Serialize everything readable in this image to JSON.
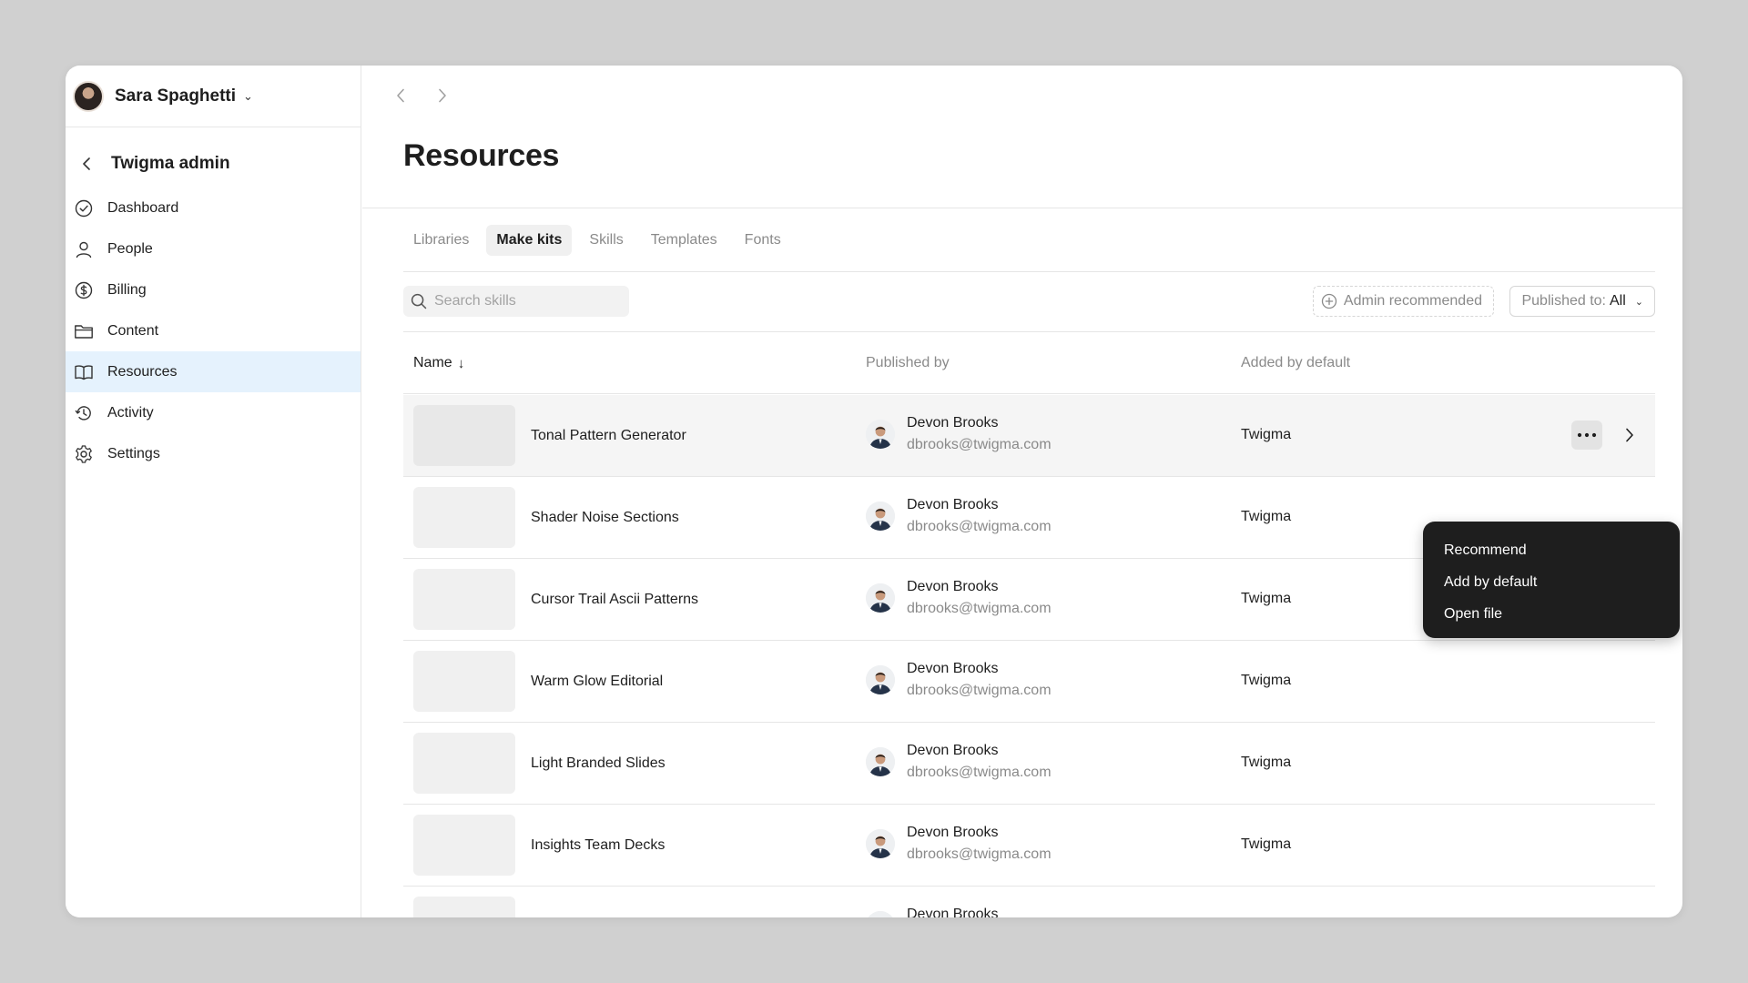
{
  "account": {
    "name": "Sara Spaghetti"
  },
  "org": {
    "title": "Twigma admin"
  },
  "nav": [
    {
      "label": "Dashboard",
      "icon": "check-circle-icon"
    },
    {
      "label": "People",
      "icon": "person-icon"
    },
    {
      "label": "Billing",
      "icon": "dollar-circle-icon"
    },
    {
      "label": "Content",
      "icon": "folder-icon"
    },
    {
      "label": "Resources",
      "icon": "book-icon",
      "active": true
    },
    {
      "label": "Activity",
      "icon": "history-icon"
    },
    {
      "label": "Settings",
      "icon": "gear-icon"
    }
  ],
  "page": {
    "title": "Resources"
  },
  "tabs": [
    "Libraries",
    "Make kits",
    "Skills",
    "Templates",
    "Fonts"
  ],
  "active_tab": "Make kits",
  "search": {
    "placeholder": "Search skills",
    "value": ""
  },
  "filters": {
    "admin_recommended": "Admin recommended",
    "published_label": "Published to:",
    "published_value": "All"
  },
  "table": {
    "columns": {
      "name": "Name",
      "published_by": "Published by",
      "added_by_default": "Added by default"
    },
    "rows": [
      {
        "name": "Tonal Pattern Generator",
        "publisher": "Devon Brooks",
        "email": "dbrooks@twigma.com",
        "added": "Twigma"
      },
      {
        "name": "Shader Noise Sections",
        "publisher": "Devon Brooks",
        "email": "dbrooks@twigma.com",
        "added": "Twigma"
      },
      {
        "name": "Cursor Trail Ascii Patterns",
        "publisher": "Devon Brooks",
        "email": "dbrooks@twigma.com",
        "added": "Twigma"
      },
      {
        "name": "Warm Glow Editorial",
        "publisher": "Devon Brooks",
        "email": "dbrooks@twigma.com",
        "added": "Twigma"
      },
      {
        "name": "Light Branded Slides",
        "publisher": "Devon Brooks",
        "email": "dbrooks@twigma.com",
        "added": "Twigma"
      },
      {
        "name": "Insights Team Decks",
        "publisher": "Devon Brooks",
        "email": "dbrooks@twigma.com",
        "added": "Twigma"
      },
      {
        "name": "",
        "publisher": "Devon Brooks",
        "email": "",
        "added": ""
      }
    ]
  },
  "context_menu": {
    "items": [
      "Recommend",
      "Add by default",
      "Open file"
    ]
  },
  "colors": {
    "active_nav_bg": "#e5f2fd",
    "menu_bg": "#1e1e1e",
    "backdrop": "#d0d0d0"
  }
}
